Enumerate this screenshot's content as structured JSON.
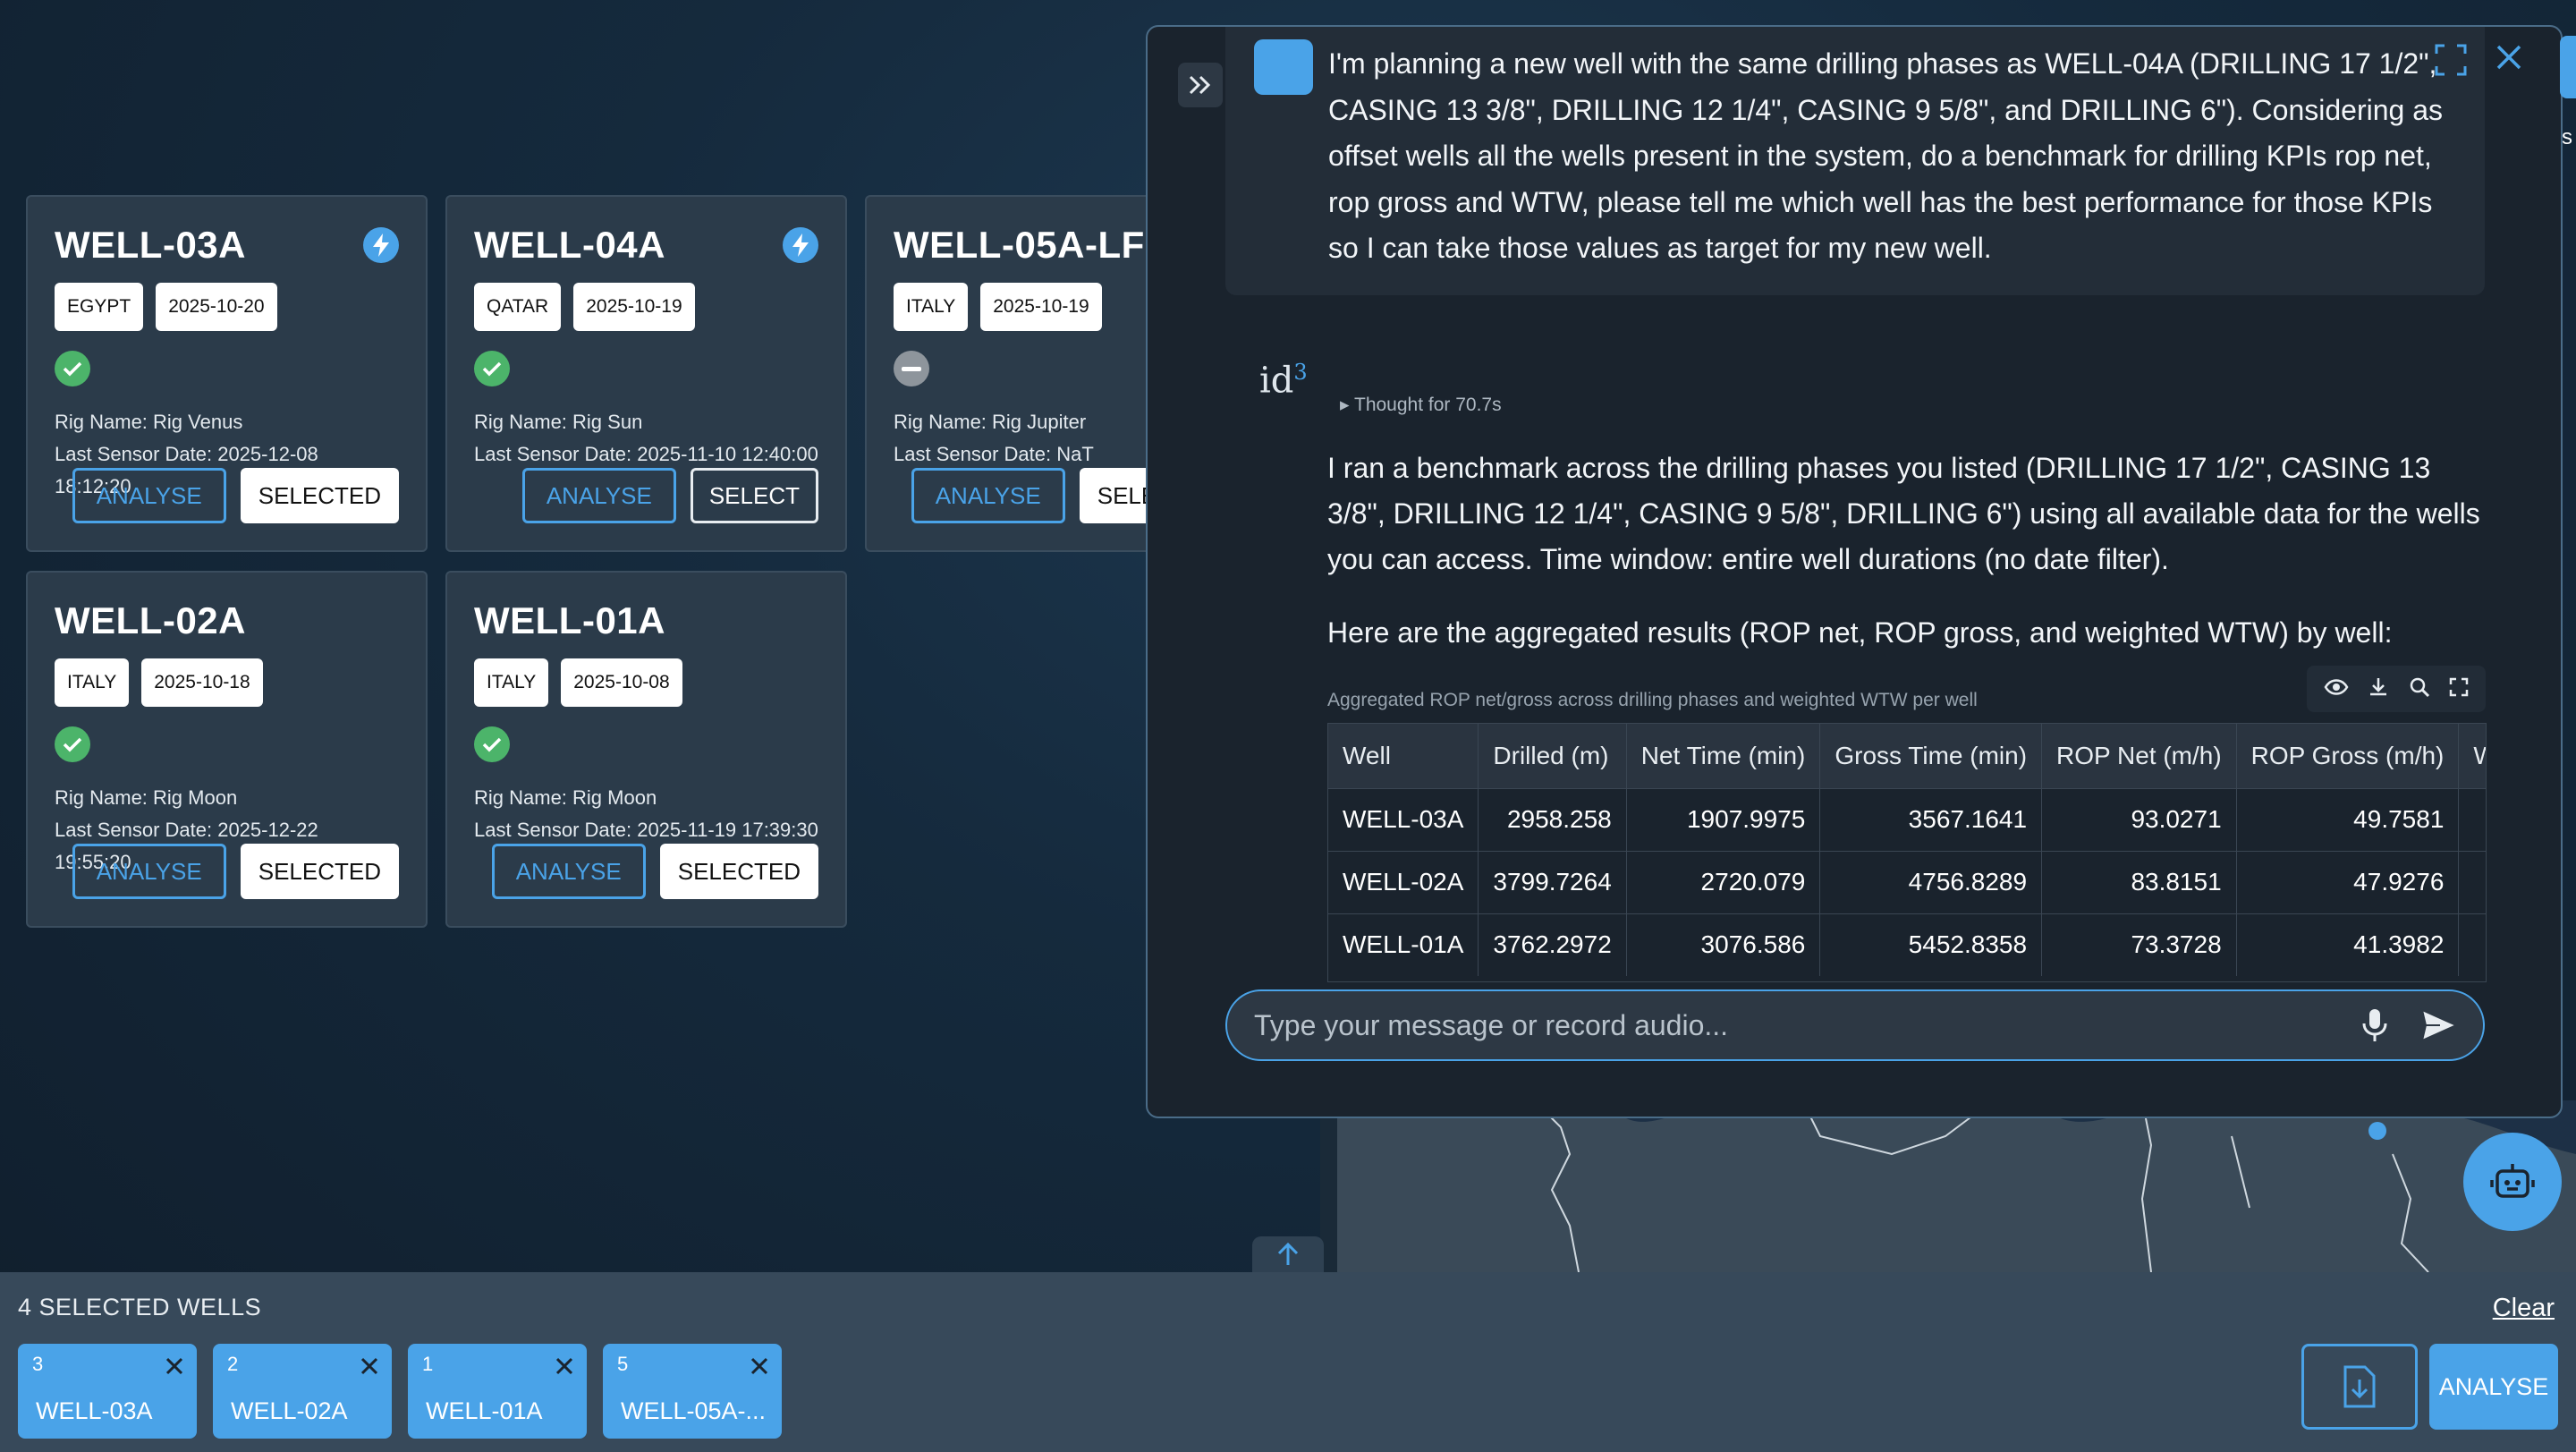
{
  "wells": [
    {
      "name": "WELL-03A",
      "country": "EGYPT",
      "date": "2025-10-20",
      "status": "ok",
      "live": true,
      "rig": "Rig Name: Rig Venus",
      "sensor": "Last Sensor Date: 2025-12-08 18:12:20",
      "analyse": "ANALYSE",
      "select_state": "SELECTED"
    },
    {
      "name": "WELL-04A",
      "country": "QATAR",
      "date": "2025-10-19",
      "status": "ok",
      "live": true,
      "rig": "Rig Name: Rig Sun",
      "sensor": "Last Sensor Date: 2025-11-10 12:40:00",
      "analyse": "ANALYSE",
      "select_state": "SELECT"
    },
    {
      "name": "WELL-05A-LF",
      "country": "ITALY",
      "date": "2025-10-19",
      "status": "na",
      "live": false,
      "rig": "Rig Name: Rig Jupiter",
      "sensor": "Last Sensor Date: NaT",
      "analyse": "ANALYSE",
      "select_state": "SELECTED"
    },
    {
      "name": "WELL-02A",
      "country": "ITALY",
      "date": "2025-10-18",
      "status": "ok",
      "live": false,
      "rig": "Rig Name: Rig Moon",
      "sensor": "Last Sensor Date: 2025-12-22 19:55:20",
      "analyse": "ANALYSE",
      "select_state": "SELECTED"
    },
    {
      "name": "WELL-01A",
      "country": "ITALY",
      "date": "2025-10-08",
      "status": "ok",
      "live": false,
      "rig": "Rig Name: Rig Moon",
      "sensor": "Last Sensor Date: 2025-11-19 17:39:30",
      "analyse": "ANALYSE",
      "select_state": "SELECTED"
    }
  ],
  "chat": {
    "user_message": "I'm planning a new well with the same drilling phases as WELL-04A (DRILLING 17 1/2\", CASING 13 3/8\", DRILLING 12 1/4\", CASING 9 5/8\", and DRILLING 6\"). Considering as offset wells all the wells present in the system, do a benchmark for drilling KPIs rop net, rop gross and WTW, please tell me which well has the best performance for those KPIs so I can take those values as target for my new well.",
    "bot_logo": "id",
    "bot_logo_sup": "3",
    "thought": "Thought for 70.7s",
    "reply_p1": "I ran a benchmark across the drilling phases you listed (DRILLING 17 1/2\", CASING 13 3/8\", DRILLING 12 1/4\", CASING 9 5/8\", DRILLING 6\") using all available data for the wells you can access. Time window: entire well durations (no date filter).",
    "reply_p2": "Here are the aggregated results (ROP net, ROP gross, and weighted WTW) by well:",
    "table_caption": "Aggregated ROP net/gross across drilling phases and weighted WTW per well",
    "table_headers": [
      "Well",
      "Drilled (m)",
      "Net Time (min)",
      "Gross Time (min)",
      "ROP Net (m/h)",
      "ROP Gross (m/h)",
      "W"
    ],
    "table_rows": [
      [
        "WELL-03A",
        "2958.258",
        "1907.9975",
        "3567.1641",
        "93.0271",
        "49.7581",
        ""
      ],
      [
        "WELL-02A",
        "3799.7264",
        "2720.079",
        "4756.8289",
        "83.8151",
        "47.9276",
        ""
      ],
      [
        "WELL-01A",
        "3762.2972",
        "3076.586",
        "5452.8358",
        "73.3728",
        "41.3982",
        ""
      ]
    ],
    "input_placeholder": "Type your message or record audio..."
  },
  "right_sliver_text": "s",
  "bottom": {
    "selected_count": "4 SELECTED WELLS",
    "clear": "Clear",
    "chips": [
      {
        "num": "3",
        "label": "WELL-03A"
      },
      {
        "num": "2",
        "label": "WELL-02A"
      },
      {
        "num": "1",
        "label": "WELL-01A"
      },
      {
        "num": "5",
        "label": "WELL-05A-..."
      }
    ],
    "analyse": "ANALYSE"
  },
  "colors": {
    "accent": "#4aa3e8",
    "ok": "#4cb46a",
    "card_bg": "#2b3b4a",
    "chat_bg": "#1a232d"
  }
}
